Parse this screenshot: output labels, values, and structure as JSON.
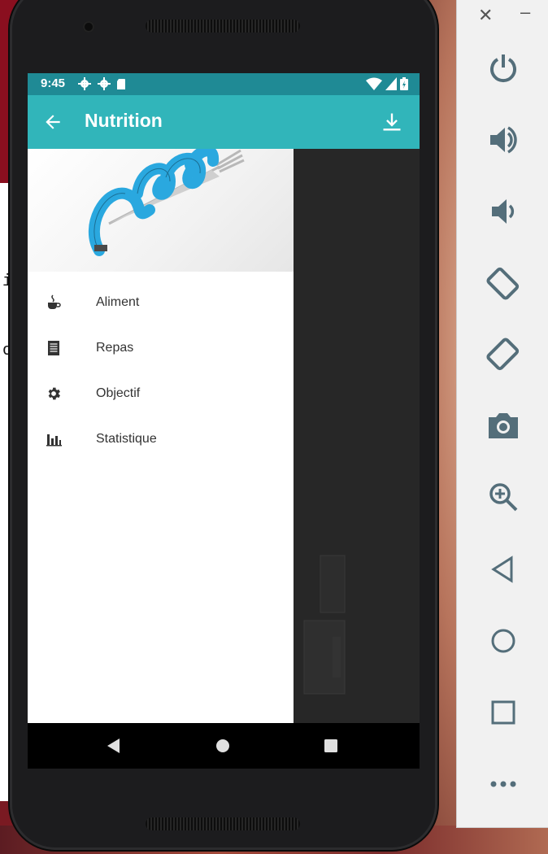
{
  "status_bar": {
    "time": "9:45"
  },
  "toolbar": {
    "title": "Nutrition"
  },
  "drawer": {
    "items": [
      {
        "label": "Aliment",
        "icon": "coffee-cup-icon"
      },
      {
        "label": "Repas",
        "icon": "document-list-icon"
      },
      {
        "label": "Objectif",
        "icon": "settings-gear-icon"
      },
      {
        "label": "Statistique",
        "icon": "bar-chart-icon"
      }
    ]
  },
  "background_left": {
    "fragments": [
      "i",
      "o"
    ]
  },
  "colors": {
    "status_bar": "#1f8a95",
    "toolbar": "#31b5ba",
    "tape_blue": "#2aa8df"
  },
  "emulator_panel": {
    "buttons": [
      "power-icon",
      "volume-up-icon",
      "volume-down-icon",
      "rotate-left-icon",
      "rotate-right-icon",
      "camera-icon",
      "zoom-icon",
      "back-icon",
      "home-icon",
      "overview-icon",
      "more-icon"
    ]
  }
}
